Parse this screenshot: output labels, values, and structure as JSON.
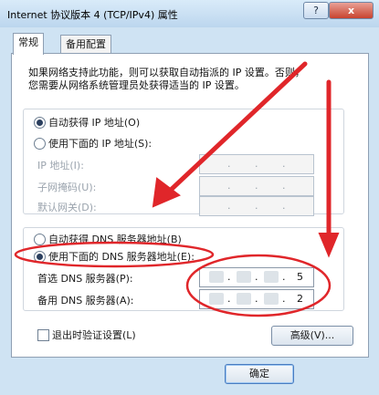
{
  "window": {
    "title": "Internet 协议版本 4 (TCP/IPv4) 属性",
    "help_label": "?",
    "close_label": "x"
  },
  "tabs": [
    {
      "label": "常规",
      "active": true
    },
    {
      "label": "备用配置",
      "active": false
    }
  ],
  "intro": {
    "line1": "如果网络支持此功能，则可以获取自动指派的 IP 设置。否则，",
    "line2": "您需要从网络系统管理员处获得适当的 IP 设置。"
  },
  "ip_section": {
    "auto_label": "自动获得 IP 地址(O)",
    "auto_selected": true,
    "manual_label": "使用下面的 IP 地址(S):",
    "manual_selected": false,
    "fields": [
      {
        "label": "IP 地址(I):"
      },
      {
        "label": "子网掩码(U):"
      },
      {
        "label": "默认网关(D):"
      }
    ]
  },
  "dns_section": {
    "auto_label": "自动获得 DNS 服务器地址(B)",
    "auto_selected": false,
    "manual_label": "使用下面的 DNS 服务器地址(E):",
    "manual_selected": true,
    "preferred_label": "首选 DNS 服务器(P):",
    "preferred_last": "5",
    "alternate_label": "备用 DNS 服务器(A):",
    "alternate_last": "2"
  },
  "validate_label": "退出时验证设置(L)",
  "validate_checked": false,
  "advanced_label": "高级(V)...",
  "ok_label": "确定",
  "annotation_color": "#e0262a"
}
